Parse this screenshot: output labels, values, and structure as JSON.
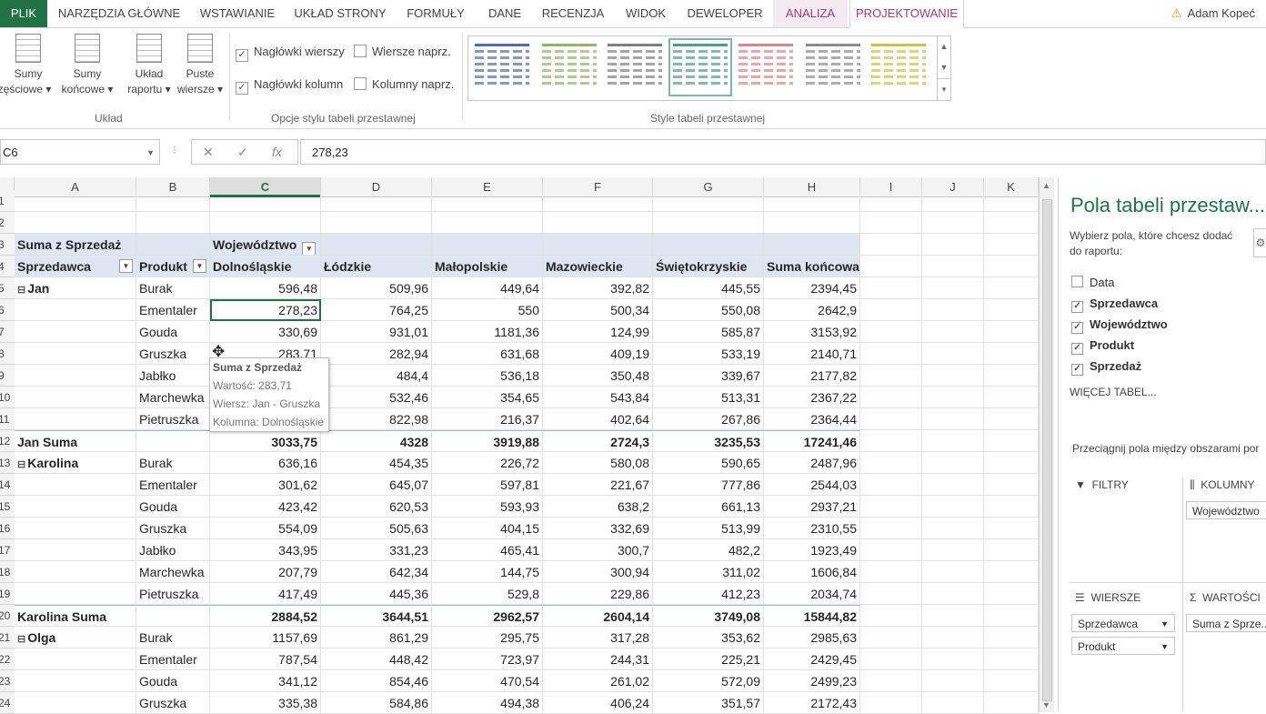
{
  "ribbon_tabs": [
    "PLIK",
    "NARZĘDZIA GŁÓWNE",
    "WSTAWIANIE",
    "UKŁAD STRONY",
    "FORMUŁY",
    "DANE",
    "RECENZJA",
    "WIDOK",
    "DEWELOPER",
    "ANALIZA",
    "PROJEKTOWANIE"
  ],
  "user": "Adam Kopeć",
  "ribbon": {
    "layout_buttons": [
      {
        "line1": "Sumy",
        "line2": "częściowe ▾"
      },
      {
        "line1": "Sumy",
        "line2": "końcowe ▾"
      },
      {
        "line1": "Układ",
        "line2": "raportu ▾"
      },
      {
        "line1": "Puste",
        "line2": "wiersze ▾"
      }
    ],
    "group_layout": "Układ",
    "options": {
      "row_headers": "Nagłówki wierszy",
      "col_headers": "Nagłówki kolumn",
      "banded_rows": "Wiersze naprz.",
      "banded_cols": "Kolumny naprz."
    },
    "group_options": "Opcje stylu tabeli przestawnej",
    "group_styles": "Style tabeli przestawnej",
    "style_colors": [
      "#4f6fa5",
      "#8fb36b",
      "#7f7f7f",
      "#4f9e7f",
      "#d98686",
      "#8c8c8c",
      "#c9c24a"
    ]
  },
  "formula_bar": {
    "cell_ref": "C6",
    "value": "278,23"
  },
  "columns": [
    "A",
    "B",
    "C",
    "D",
    "E",
    "F",
    "G",
    "H",
    "I",
    "J",
    "K"
  ],
  "rows": [
    "1",
    "2",
    "3",
    "4",
    "5",
    "6",
    "7",
    "8",
    "9",
    "10",
    "11",
    "12",
    "13",
    "14",
    "15",
    "16",
    "17",
    "18",
    "19",
    "20",
    "21",
    "22",
    "23",
    "24"
  ],
  "pivot": {
    "corner_label": "Suma z Sprzedaż",
    "col_field": "Województwo",
    "row_field1": "Sprzedawca",
    "row_field2": "Produkt",
    "col_headers": [
      "Dolnośląskie",
      "Łódzkie",
      "Małopolskie",
      "Mazowieckie",
      "Świętokrzyskie",
      "Suma końcowa"
    ],
    "groups": [
      {
        "name": "Jan",
        "total_label": "Jan Suma",
        "total": [
          "3033,75",
          "4328",
          "3919,88",
          "2724,3",
          "3235,53",
          "17241,46"
        ],
        "rows": [
          {
            "p": "Burak",
            "v": [
              "596,48",
              "509,96",
              "449,64",
              "392,82",
              "445,55",
              "2394,45"
            ]
          },
          {
            "p": "Ementaler",
            "v": [
              "278,23",
              "764,25",
              "550",
              "500,34",
              "550,08",
              "2642,9"
            ]
          },
          {
            "p": "Gouda",
            "v": [
              "330,69",
              "931,01",
              "1181,36",
              "124,99",
              "585,87",
              "3153,92"
            ]
          },
          {
            "p": "Gruszka",
            "v": [
              "283,71",
              "282,94",
              "631,68",
              "409,19",
              "533,19",
              "2140,71"
            ]
          },
          {
            "p": "Jabłko",
            "v": [
              "",
              "484,4",
              "536,18",
              "350,48",
              "339,67",
              "2177,82"
            ]
          },
          {
            "p": "Marchewka",
            "v": [
              "",
              "532,46",
              "354,65",
              "543,84",
              "513,31",
              "2367,22"
            ]
          },
          {
            "p": "Pietruszka",
            "v": [
              "",
              "822,98",
              "216,37",
              "402,64",
              "267,86",
              "2364,44"
            ]
          }
        ]
      },
      {
        "name": "Karolina",
        "total_label": "Karolina Suma",
        "total": [
          "2884,52",
          "3644,51",
          "2962,57",
          "2604,14",
          "3749,08",
          "15844,82"
        ],
        "rows": [
          {
            "p": "Burak",
            "v": [
              "636,16",
              "454,35",
              "226,72",
              "580,08",
              "590,65",
              "2487,96"
            ]
          },
          {
            "p": "Ementaler",
            "v": [
              "301,62",
              "645,07",
              "597,81",
              "221,67",
              "777,86",
              "2544,03"
            ]
          },
          {
            "p": "Gouda",
            "v": [
              "423,42",
              "620,53",
              "593,93",
              "638,2",
              "661,13",
              "2937,21"
            ]
          },
          {
            "p": "Gruszka",
            "v": [
              "554,09",
              "505,63",
              "404,15",
              "332,69",
              "513,99",
              "2310,55"
            ]
          },
          {
            "p": "Jabłko",
            "v": [
              "343,95",
              "331,23",
              "465,41",
              "300,7",
              "482,2",
              "1923,49"
            ]
          },
          {
            "p": "Marchewka",
            "v": [
              "207,79",
              "642,34",
              "144,75",
              "300,94",
              "311,02",
              "1606,84"
            ]
          },
          {
            "p": "Pietruszka",
            "v": [
              "417,49",
              "445,36",
              "529,8",
              "229,86",
              "412,23",
              "2034,74"
            ]
          }
        ]
      },
      {
        "name": "Olga",
        "rows": [
          {
            "p": "Burak",
            "v": [
              "1157,69",
              "861,29",
              "295,75",
              "317,28",
              "353,62",
              "2985,63"
            ]
          },
          {
            "p": "Ementaler",
            "v": [
              "787,54",
              "448,42",
              "723,97",
              "244,31",
              "225,21",
              "2429,45"
            ]
          },
          {
            "p": "Gouda",
            "v": [
              "341,12",
              "854,46",
              "470,54",
              "261,02",
              "572,09",
              "2499,23"
            ]
          },
          {
            "p": "Gruszka",
            "v": [
              "335,38",
              "584,86",
              "494,38",
              "406,24",
              "351,57",
              "2172,43"
            ]
          }
        ]
      }
    ]
  },
  "tooltip": {
    "title": "Suma z Sprzedaż",
    "value": "Wartość: 283,71",
    "row": "Wiersz: Jan - Gruszka",
    "col": "Kolumna: Dolnośląskie"
  },
  "pane": {
    "title": "Pola tabeli przestaw...",
    "subtitle": "Wybierz pola, które chcesz dodać do raportu:",
    "fields": [
      {
        "label": "Data",
        "checked": false
      },
      {
        "label": "Sprzedawca",
        "checked": true
      },
      {
        "label": "Województwo",
        "checked": true
      },
      {
        "label": "Produkt",
        "checked": true
      },
      {
        "label": "Sprzedaż",
        "checked": true
      }
    ],
    "more": "WIĘCEJ TABEL...",
    "drag": "Przeciągnij pola między obszarami por",
    "filters": "FILTRY",
    "columns": "KOLUMNY",
    "rows": "WIERSZE",
    "values": "WARTOŚCI",
    "col_chip": "Województwo",
    "row_chip1": "Sprzedawca",
    "row_chip2": "Produkt",
    "val_chip": "Suma z Sprze..."
  }
}
